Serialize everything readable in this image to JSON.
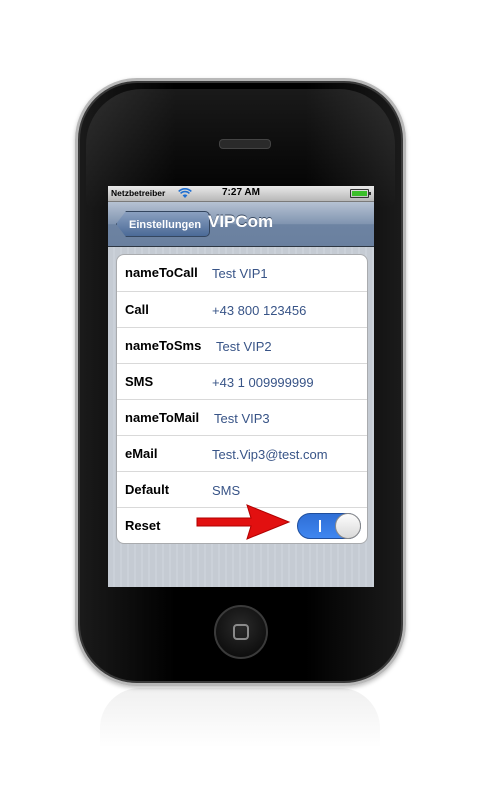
{
  "status_bar": {
    "carrier": "Netzbetreiber",
    "time": "7:27 AM",
    "wifi_icon": "wifi-icon",
    "battery_icon": "battery-icon"
  },
  "nav": {
    "back_label": "Einstellungen",
    "title": "VIPCom"
  },
  "settings": {
    "rows": [
      {
        "label": "nameToCall",
        "value": "Test VIP1"
      },
      {
        "label": "Call",
        "value": "+43 800 123456"
      },
      {
        "label": "nameToSms",
        "value": "Test VIP2"
      },
      {
        "label": "SMS",
        "value": "+43 1 009999999"
      },
      {
        "label": "nameToMail",
        "value": "Test VIP3"
      },
      {
        "label": "eMail",
        "value": "Test.Vip3@test.com"
      },
      {
        "label": "Default",
        "value": "SMS"
      }
    ],
    "reset": {
      "label": "Reset",
      "toggle_on_symbol": "I",
      "toggle_state": "on"
    }
  },
  "annotation": {
    "icon": "red-arrow-icon",
    "color": "#e21010"
  },
  "colors": {
    "value_text": "#385487",
    "toggle_on": "#3f86f0",
    "arrow": "#e21010"
  }
}
